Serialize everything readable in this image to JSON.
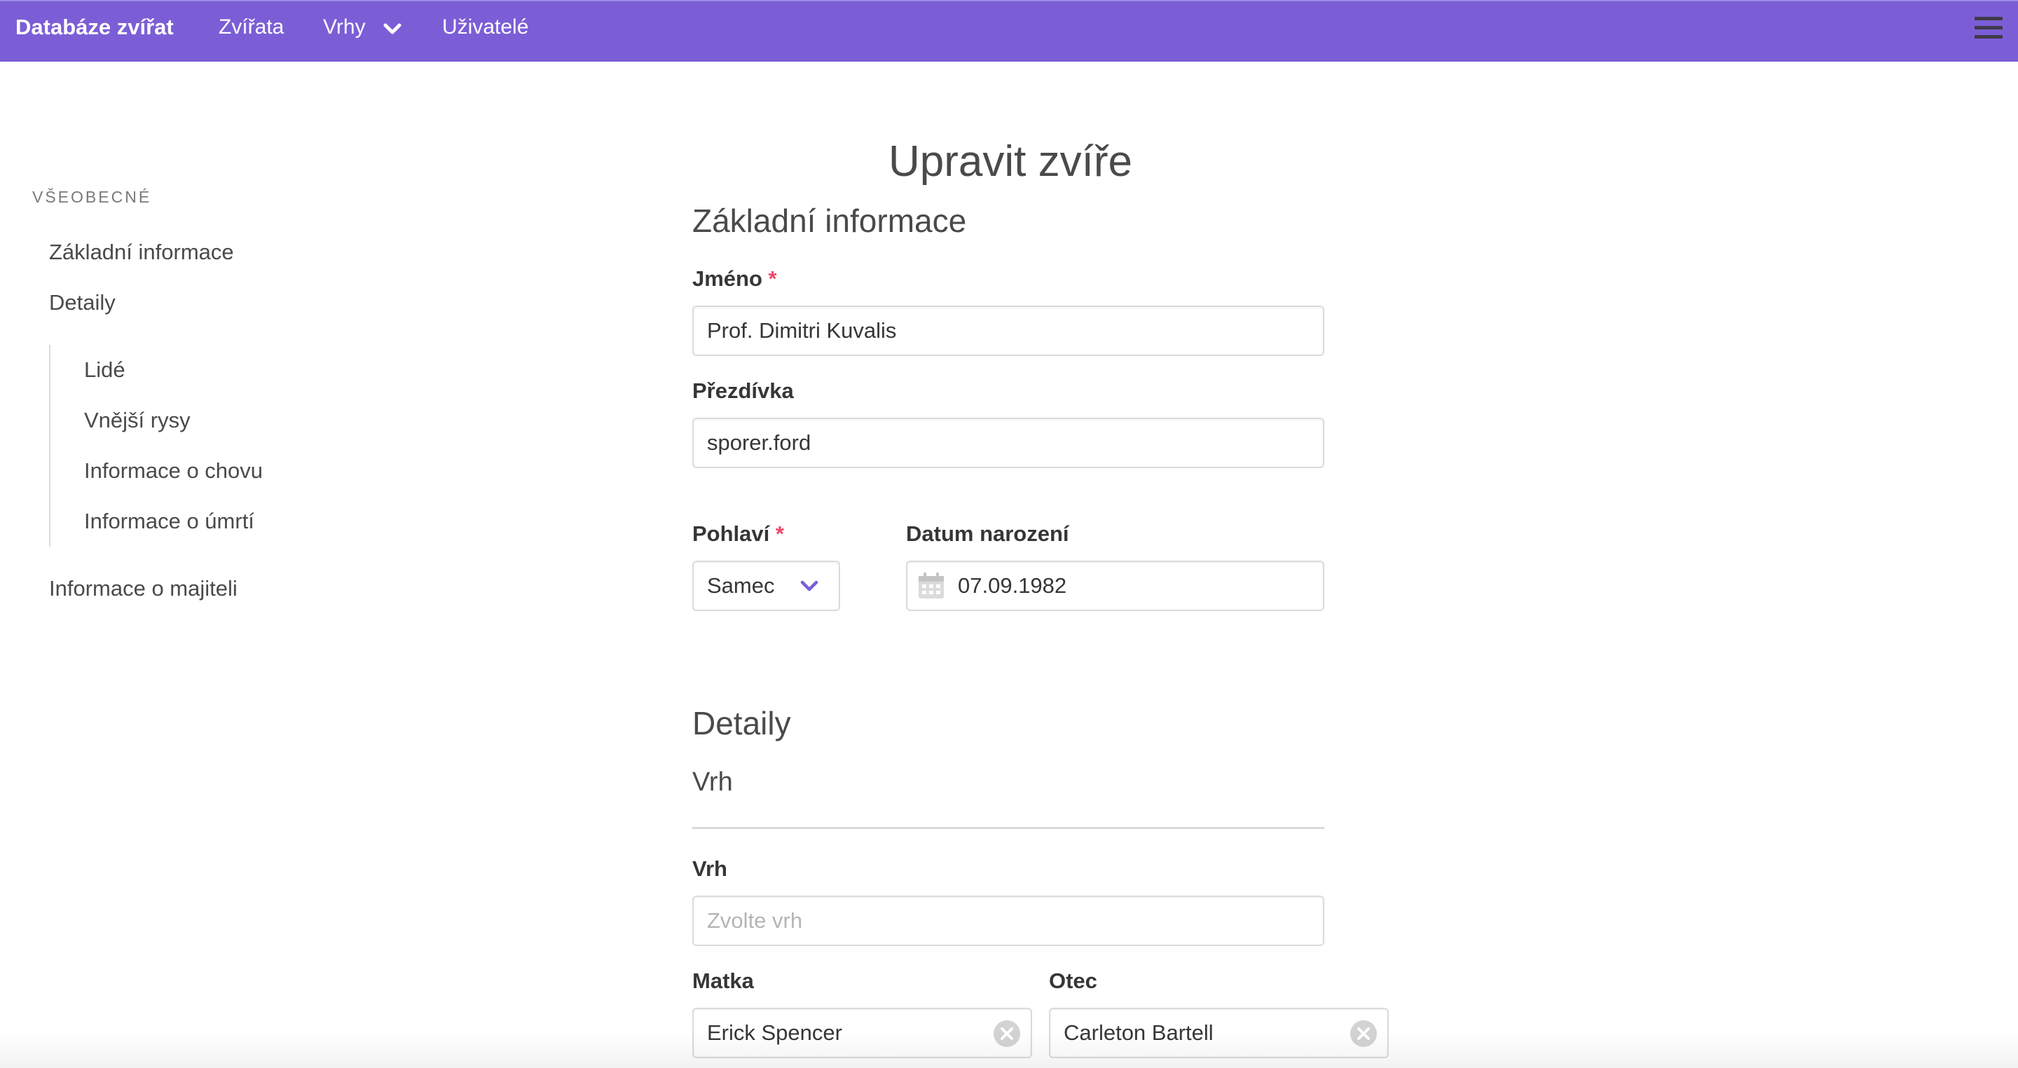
{
  "navbar": {
    "brand": "Databáze zvířat",
    "items": [
      {
        "label": "Zvířata"
      },
      {
        "label": "Vrhy"
      },
      {
        "label": "Uživatelé"
      }
    ],
    "accent_color": "#7b5ed6"
  },
  "sidebar": {
    "section_label": "VŠEOBECNÉ",
    "items": [
      {
        "label": "Základní informace"
      },
      {
        "label": "Detaily"
      }
    ],
    "subitems": [
      {
        "label": "Lidé"
      },
      {
        "label": "Vnější rysy"
      },
      {
        "label": "Informace o chovu"
      },
      {
        "label": "Informace o úmrtí"
      }
    ],
    "footer_item": {
      "label": "Informace o majiteli"
    }
  },
  "page": {
    "title": "Upravit zvíře"
  },
  "basic": {
    "section_title": "Základní informace",
    "required_mark": "*",
    "name": {
      "label": "Jméno",
      "value": "Prof. Dimitri Kuvalis"
    },
    "nickname": {
      "label": "Přezdívka",
      "value": "sporer.ford"
    },
    "sex": {
      "label": "Pohlaví",
      "value": "Samec"
    },
    "birthdate": {
      "label": "Datum narození",
      "value": "07.09.1982"
    }
  },
  "details": {
    "section_title": "Detaily",
    "subsection_title": "Vrh",
    "litter": {
      "label": "Vrh",
      "placeholder": "Zvolte vrh"
    },
    "mother": {
      "label": "Matka",
      "value": "Erick Spencer"
    },
    "father": {
      "label": "Otec",
      "value": "Carleton Bartell"
    }
  }
}
